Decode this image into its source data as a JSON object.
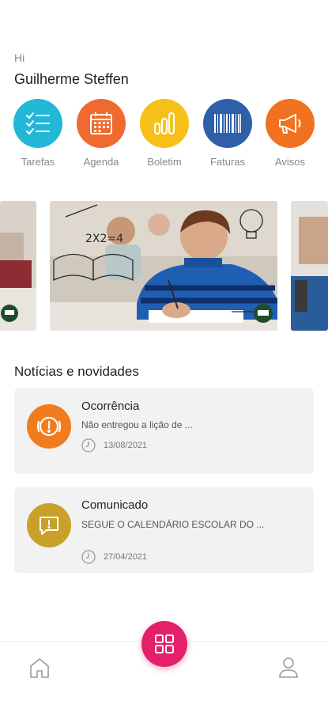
{
  "header": {
    "greeting": "Hi",
    "user_name": "Guilherme Steffen"
  },
  "shortcuts": [
    {
      "label": "Tarefas",
      "icon": "checklist-icon",
      "color": "#22b7d6"
    },
    {
      "label": "Agenda",
      "icon": "calendar-icon",
      "color": "#ef6a2e"
    },
    {
      "label": "Boletim",
      "icon": "bar-chart-icon",
      "color": "#f6c019"
    },
    {
      "label": "Faturas",
      "icon": "barcode-icon",
      "color": "#2f5fa7"
    },
    {
      "label": "Avisos",
      "icon": "megaphone-icon",
      "color": "#f0721f"
    }
  ],
  "carousel": {
    "banner_text": "2X2=4"
  },
  "news": {
    "section_title": "Notícias e novidades",
    "items": [
      {
        "title": "Ocorrência",
        "description": "Não entregou a lição de ...",
        "date": "13/08/2021",
        "icon": "alert-icon",
        "color": "#f07c1e"
      },
      {
        "title": "Comunicado",
        "description": "SEGUE O CALENDÁRIO ESCOLAR DO ...",
        "date": "27/04/2021",
        "icon": "message-icon",
        "color": "#c9a128"
      }
    ]
  },
  "bottom_nav": {
    "items": [
      "home-icon",
      "apps-icon",
      "profile-icon"
    ],
    "fab_color": "#e5206a"
  }
}
